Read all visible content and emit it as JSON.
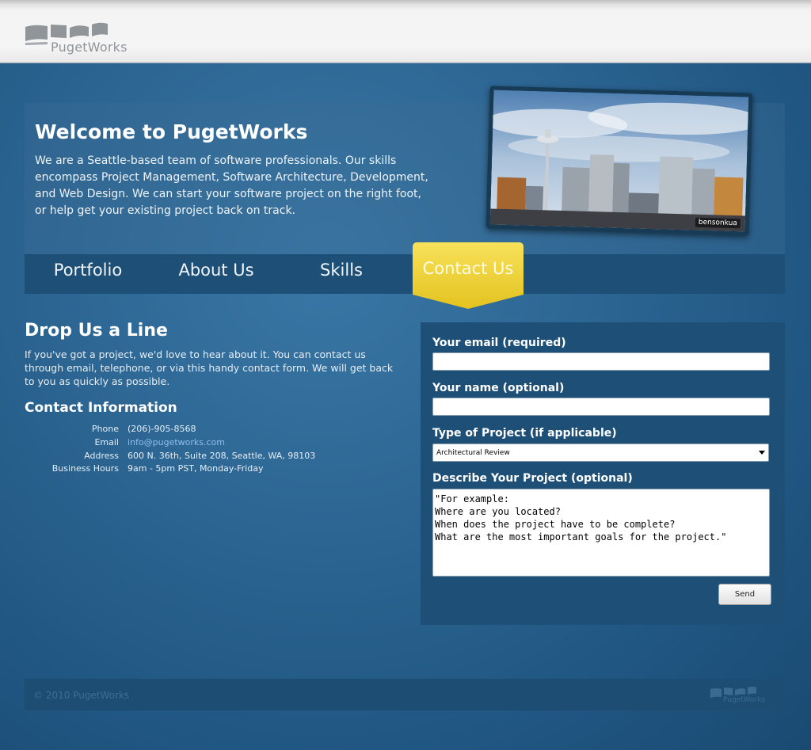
{
  "brand": {
    "name": "PugetWorks"
  },
  "hero": {
    "title": "Welcome to PugetWorks",
    "text": "We are a Seattle-based team of software professionals. Our skills encompass Project Management, Software Architecture, Development, and Web Design. We can start your software project on the right foot, or help get your existing project back on track.",
    "photo_credit": "bensonkua"
  },
  "nav": {
    "items": [
      {
        "label": "Portfolio"
      },
      {
        "label": "About Us"
      },
      {
        "label": "Skills"
      },
      {
        "label": "Contact Us",
        "active": true
      }
    ],
    "active_color": "#f1d33a"
  },
  "contact": {
    "heading": "Drop Us a Line",
    "intro": "If you've got a project, we'd love to hear about it. You can contact us through email, telephone, or via this handy contact form. We will get back to you as quickly as possible.",
    "info_heading": "Contact Information",
    "info": [
      {
        "label": "Phone",
        "value": "(206)-905-8568"
      },
      {
        "label": "Email",
        "value": "info@pugetworks.com"
      },
      {
        "label": "Address",
        "value": "600 N. 36th, Suite 208, Seattle, WA, 98103"
      },
      {
        "label": "Business Hours",
        "value": "9am - 5pm PST, Monday-Friday"
      }
    ]
  },
  "form": {
    "email_label": "Your email (required)",
    "email_value": "",
    "name_label": "Your name (optional)",
    "name_value": "",
    "type_label": "Type of Project (if applicable)",
    "type_selected": "Architectural Review",
    "describe_label": "Describe Your Project (optional)",
    "describe_value": "\"For example:\nWhere are you located?\nWhen does the project have to be complete?\nWhat are the most important goals for the project.\"",
    "send_label": "Send"
  },
  "footer": {
    "copyright": "© 2010 PugetWorks",
    "logo_text": "PugetWorks"
  }
}
